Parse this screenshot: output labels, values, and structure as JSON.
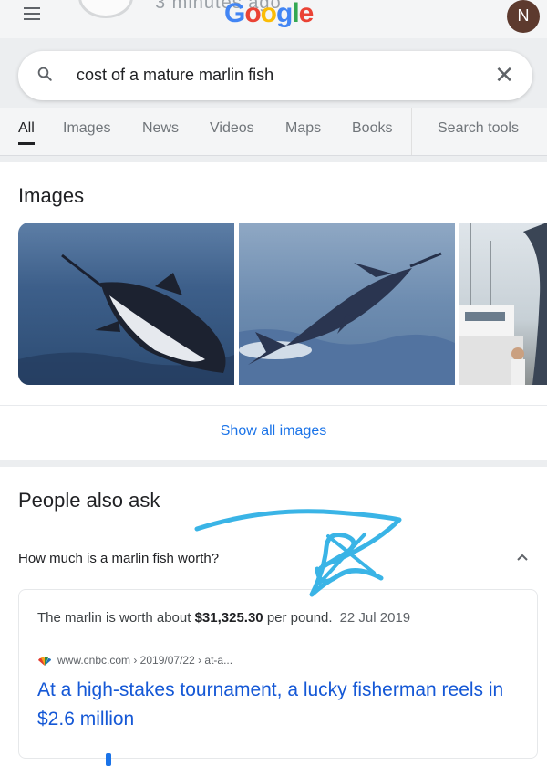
{
  "status": {
    "time_ago": "3 minutes ago"
  },
  "header": {
    "logo_parts": [
      "G",
      "o",
      "o",
      "g",
      "l",
      "e"
    ],
    "user_initial": "N"
  },
  "search": {
    "query": "cost of a mature marlin fish"
  },
  "tabs": [
    {
      "label": "All",
      "active": true
    },
    {
      "label": "Images"
    },
    {
      "label": "News"
    },
    {
      "label": "Videos"
    },
    {
      "label": "Maps"
    },
    {
      "label": "Books"
    },
    {
      "label": "Search tools"
    }
  ],
  "images_section": {
    "title": "Images",
    "show_all_label": "Show all images"
  },
  "people_also_ask": {
    "title": "People also ask",
    "question": "How much is a marlin fish worth?",
    "answer": {
      "text_before": "The marlin is worth about ",
      "highlight": "$31,325.30",
      "text_after": " per pound.",
      "date": "22 Jul 2019",
      "source": "www.cnbc.com › 2019/07/22 › at-a...",
      "result_title": "At a high-stakes tournament, a lucky fisherman reels in $2.6 million"
    }
  },
  "colors": {
    "link": "#1558d6",
    "accent": "#1a73e8",
    "scribble": "#3ab4e6"
  }
}
